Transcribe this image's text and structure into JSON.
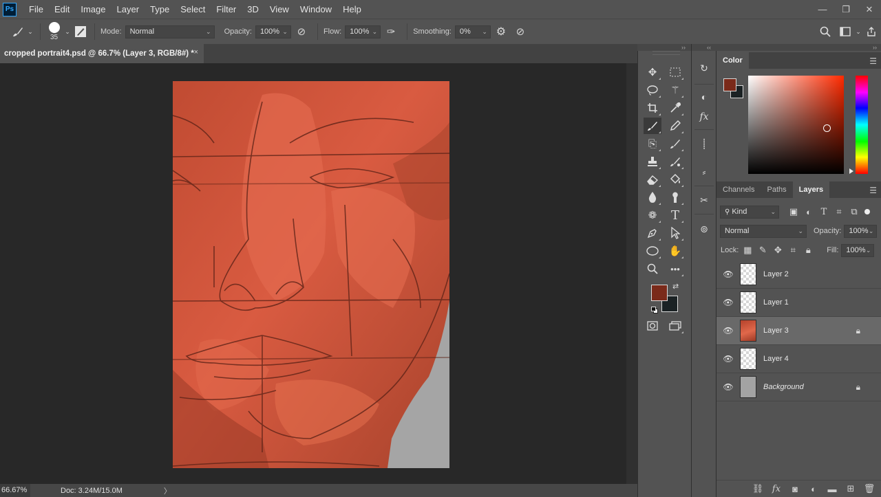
{
  "app": {
    "logo": "Ps"
  },
  "menu": [
    "File",
    "Edit",
    "Image",
    "Layer",
    "Type",
    "Select",
    "Filter",
    "3D",
    "View",
    "Window",
    "Help"
  ],
  "window_controls": {
    "minimize": "—",
    "restore": "❐",
    "close": "✕"
  },
  "options": {
    "brush_size": "35",
    "mode_label": "Mode:",
    "mode_value": "Normal",
    "opacity_label": "Opacity:",
    "opacity_value": "100%",
    "flow_label": "Flow:",
    "flow_value": "100%",
    "smoothing_label": "Smoothing:",
    "smoothing_value": "0%"
  },
  "document": {
    "tab_title": "cropped portrait4.psd @ 66.7% (Layer 3, RGB/8#) *",
    "close": "×"
  },
  "status": {
    "zoom": "66.67%",
    "doc_info": "Doc: 3.24M/15.0M",
    "arrow": "〉"
  },
  "colors": {
    "foreground": "#7a2a1a",
    "background": "#1b2224",
    "selected_hue": "#ff2a00"
  },
  "color_panel": {
    "title": "Color"
  },
  "layers_panel": {
    "tabs": [
      "Channels",
      "Paths",
      "Layers"
    ],
    "active_tab": "Layers",
    "filter_label": "Kind",
    "blend_mode": "Normal",
    "opacity_label": "Opacity:",
    "opacity_value": "100%",
    "lock_label": "Lock:",
    "fill_label": "Fill:",
    "fill_value": "100%",
    "layers": [
      {
        "name": "Layer 2",
        "visible": true,
        "locked": false,
        "selected": false,
        "thumb": "transparent"
      },
      {
        "name": "Layer 1",
        "visible": true,
        "locked": false,
        "selected": false,
        "thumb": "transparent"
      },
      {
        "name": "Layer 3",
        "visible": true,
        "locked": true,
        "selected": true,
        "thumb": "painted"
      },
      {
        "name": "Layer 4",
        "visible": true,
        "locked": false,
        "selected": false,
        "thumb": "transparent"
      },
      {
        "name": "Background",
        "visible": true,
        "locked": true,
        "selected": false,
        "thumb": "gray"
      }
    ]
  },
  "tools": [
    "move-tool",
    "marquee-tool",
    "lasso-tool",
    "quick-selection-tool",
    "crop-tool",
    "eyedropper-tool",
    "brush-tool",
    "pencil-tool",
    "clone-stamp-tool",
    "history-brush-tool",
    "stamp-tool",
    "mixer-brush-tool",
    "eraser-tool",
    "paint-bucket-tool",
    "blur-tool",
    "smudge-tool",
    "dodge-tool",
    "type-tool",
    "pen-tool",
    "path-selection-tool",
    "ellipse-tool",
    "hand-tool",
    "zoom-tool",
    "more-tools"
  ],
  "active_tool": "brush-tool"
}
